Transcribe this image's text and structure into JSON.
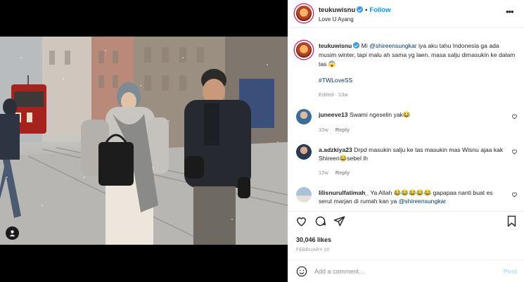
{
  "header": {
    "username": "teukuwisnu",
    "follow_label": "Follow",
    "location": "Love U Ayang",
    "more_icon": "more-horizontal-icon"
  },
  "caption": {
    "username": "teukuwisnu",
    "text_before_mention": "Mi ",
    "mention": "@shireensungkar",
    "text_after_mention": " iya aku tahu Indonesia ga ada musim winter, tapi malu ah sama yg laen. masa salju dimasukin ke dalam tas 😱",
    "hashtag": "#TWLoveSS",
    "meta": "Edited · 13w"
  },
  "comments": [
    {
      "username": "juneeve13",
      "text": "Swami ngeselin yak",
      "emoji": "😂",
      "time": "10w",
      "reply_label": "Reply"
    },
    {
      "username": "a.adzkiya23",
      "text_a": "Drpd masukin salju ke tas masukin mas Wisnu ajaa kak Shireen",
      "emoji": "😂",
      "text_b": "sebel ih",
      "time": "12w",
      "reply_label": "Reply"
    },
    {
      "username": "lilisnurulfatimah_",
      "text_a": "Ya Allah ",
      "emojis": "😂😂😂😂😂",
      "text_b": " gapapaa nanti buat es serut marjan di rumah kan ya ",
      "mention": "@shireensungkar"
    }
  ],
  "likes": "30,046 likes",
  "date": "FEBRUARY 20",
  "add_comment": {
    "placeholder": "Add a comment...",
    "post_label": "Post"
  },
  "colors": {
    "accent": "#0095f6",
    "mention": "#00376b",
    "muted": "#8e8e8e"
  }
}
